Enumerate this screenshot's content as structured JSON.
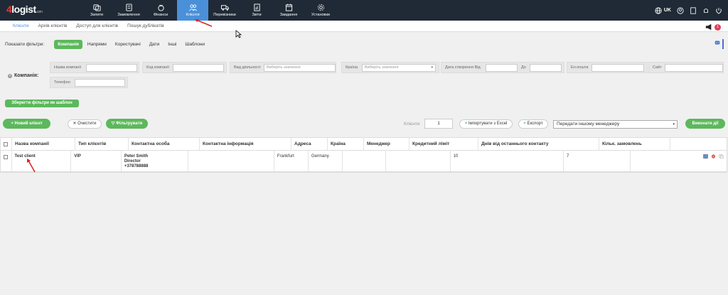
{
  "app": {
    "logo_prefix": "4",
    "logo_text": "logist",
    "logo_suffix": ".com",
    "accent": "#4a90d9",
    "green": "#5cb85c"
  },
  "nav": [
    {
      "label": "Запити",
      "icon": "requests-icon"
    },
    {
      "label": "Замовлення",
      "icon": "orders-icon"
    },
    {
      "label": "Фінанси",
      "icon": "finance-icon"
    },
    {
      "label": "Клієнти",
      "icon": "clients-icon",
      "active": true
    },
    {
      "label": "Перевізники",
      "icon": "truck-icon"
    },
    {
      "label": "Звіти",
      "icon": "reports-icon"
    },
    {
      "label": "Завдання",
      "icon": "tasks-icon"
    },
    {
      "label": "Установки",
      "icon": "settings-icon"
    }
  ],
  "topright": {
    "lang": "UK"
  },
  "subnav": [
    {
      "label": "Клієнти",
      "active": true
    },
    {
      "label": "Архів клієнтів"
    },
    {
      "label": "Доступ для клієнтів"
    },
    {
      "label": "Пошук дублікатів"
    }
  ],
  "notifications": {
    "count": "1"
  },
  "filters": {
    "label": "Показати фільтри:",
    "tabs": [
      {
        "label": "Компанія",
        "active": true
      },
      {
        "label": "Напрями"
      },
      {
        "label": "Користувачі"
      },
      {
        "label": "Дати"
      },
      {
        "label": "Інші"
      },
      {
        "label": "Шаблони"
      }
    ]
  },
  "company_panel": {
    "label": "Компанія:",
    "fields": {
      "name": "Назва компанії",
      "code": "Код компанії",
      "activity": "Вид діяльності",
      "activity_placeholder": "Виберіть значення",
      "country": "Країна",
      "country_placeholder": "Виберіть значення",
      "created_from": "Дата створення Від",
      "to": "До",
      "email": "Ел.пошта",
      "site": "Сайт",
      "phone": "Телефон"
    }
  },
  "save_template": "Зберегти фільтри як шаблон",
  "toolbar": {
    "new_client": "+ Новий клієнт",
    "clear": "Очистити",
    "filter": "Фільтрувати",
    "clients_label": "Клієнти",
    "page_value": "1",
    "import": "Імпортувати з Excel",
    "export": "Експорт",
    "transfer": "Передати іншому менеджеру",
    "execute": "Виконати дії"
  },
  "table": {
    "headers": [
      "Назва компанії",
      "Тип клієнтів",
      "Контактна особа",
      "Контактна інформація",
      "Адреса",
      "Країна",
      "Менеджер",
      "Кредитний ліміт",
      "Днів від останнього контакту",
      "Кільк. замовлень"
    ],
    "rows": [
      {
        "name": "Test client",
        "type": "VIP",
        "contact_name": "Peter Smith",
        "contact_role": "Director",
        "contact_phone": "+378788888",
        "info": "",
        "address": "Frankfurt",
        "country": "Germany",
        "manager": "",
        "credit": "",
        "days": "10",
        "orders": "7"
      }
    ]
  }
}
